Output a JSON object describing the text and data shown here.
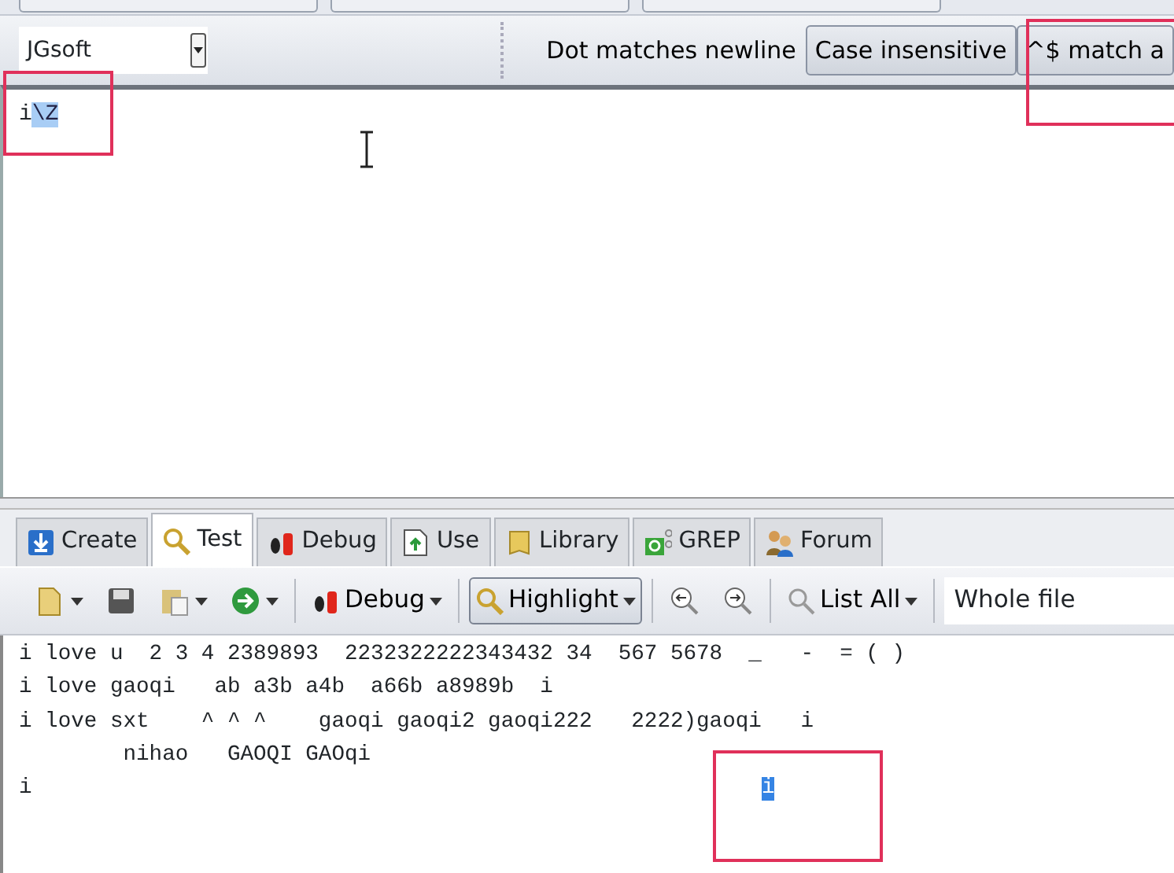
{
  "options_bar": {
    "flavor": "JGsoft",
    "toggles": [
      {
        "label": "Dot matches newline",
        "selected": false
      },
      {
        "label": "Case insensitive",
        "selected": true
      },
      {
        "label": "^$ match a",
        "selected": true
      }
    ]
  },
  "regex": {
    "segments": [
      {
        "text": "i",
        "selected": false
      },
      {
        "text": "\\Z",
        "selected": true
      }
    ]
  },
  "tabs": [
    {
      "label": "Create",
      "selected": false,
      "kind": "create"
    },
    {
      "label": "Test",
      "selected": true,
      "kind": "test"
    },
    {
      "label": "Debug",
      "selected": false,
      "kind": "debug"
    },
    {
      "label": "Use",
      "selected": false,
      "kind": "use"
    },
    {
      "label": "Library",
      "selected": false,
      "kind": "library"
    },
    {
      "label": "GREP",
      "selected": false,
      "kind": "grep"
    },
    {
      "label": "Forum",
      "selected": false,
      "kind": "forum"
    }
  ],
  "toolbar": {
    "debug": "Debug",
    "highlight": {
      "label": "Highlight",
      "selected": true
    },
    "list_all": "List All",
    "scope": "Whole file"
  },
  "test_text": {
    "lines": [
      {
        "segments": [
          {
            "text": "i love u  2 3 4 2389893  2232322222343432 34  567 5678  _   -  = ( )",
            "selected": false
          }
        ]
      },
      {
        "segments": [
          {
            "text": "i love gaoqi   ab a3b a4b  a66b a8989b  i",
            "selected": false
          }
        ]
      },
      {
        "segments": [
          {
            "text": "i love sxt    ^ ^ ^    gaoqi gaoqi2 gaoqi222   2222)gaoqi   i",
            "selected": false
          }
        ]
      },
      {
        "segments": [
          {
            "text": "        nihao   GAOQI GAOqi",
            "selected": false
          }
        ]
      },
      {
        "segments": [
          {
            "text": "i                                                        ",
            "selected": false
          },
          {
            "text": "i",
            "selected": true
          }
        ]
      }
    ]
  }
}
